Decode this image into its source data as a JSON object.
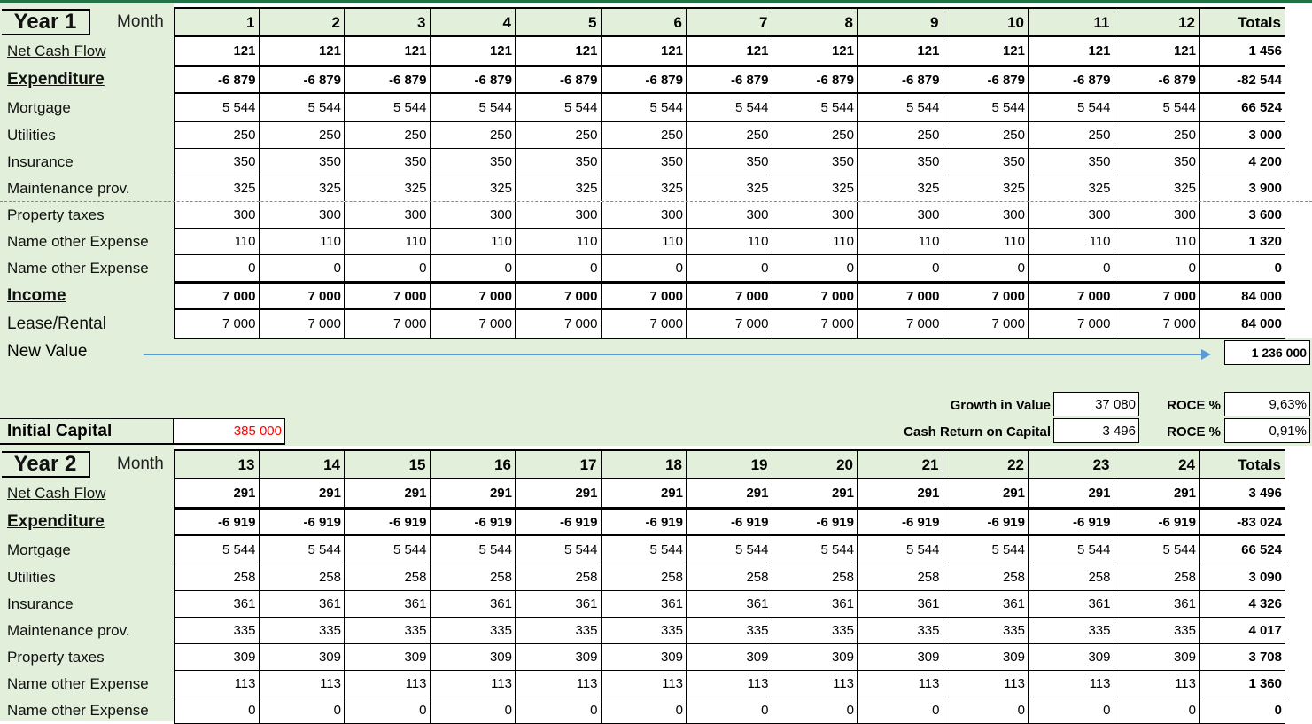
{
  "year1": {
    "title": "Year 1",
    "month_label": "Month",
    "months": [
      "1",
      "2",
      "3",
      "4",
      "5",
      "6",
      "7",
      "8",
      "9",
      "10",
      "11",
      "12"
    ],
    "totals_label": "Totals",
    "rows": [
      {
        "label": "Net Cash Flow",
        "values": [
          "121",
          "121",
          "121",
          "121",
          "121",
          "121",
          "121",
          "121",
          "121",
          "121",
          "121",
          "121"
        ],
        "total": "1 456"
      },
      {
        "label": "Expenditure",
        "values": [
          "-6 879",
          "-6 879",
          "-6 879",
          "-6 879",
          "-6 879",
          "-6 879",
          "-6 879",
          "-6 879",
          "-6 879",
          "-6 879",
          "-6 879",
          "-6 879"
        ],
        "total": "-82 544"
      },
      {
        "label": "Mortgage",
        "values": [
          "5 544",
          "5 544",
          "5 544",
          "5 544",
          "5 544",
          "5 544",
          "5 544",
          "5 544",
          "5 544",
          "5 544",
          "5 544",
          "5 544"
        ],
        "total": "66 524"
      },
      {
        "label": "Utilities",
        "values": [
          "250",
          "250",
          "250",
          "250",
          "250",
          "250",
          "250",
          "250",
          "250",
          "250",
          "250",
          "250"
        ],
        "total": "3 000"
      },
      {
        "label": "Insurance",
        "values": [
          "350",
          "350",
          "350",
          "350",
          "350",
          "350",
          "350",
          "350",
          "350",
          "350",
          "350",
          "350"
        ],
        "total": "4 200"
      },
      {
        "label": "Maintenance prov.",
        "values": [
          "325",
          "325",
          "325",
          "325",
          "325",
          "325",
          "325",
          "325",
          "325",
          "325",
          "325",
          "325"
        ],
        "total": "3 900"
      },
      {
        "label": "Property taxes",
        "values": [
          "300",
          "300",
          "300",
          "300",
          "300",
          "300",
          "300",
          "300",
          "300",
          "300",
          "300",
          "300"
        ],
        "total": "3 600"
      },
      {
        "label": "Name other Expense",
        "values": [
          "110",
          "110",
          "110",
          "110",
          "110",
          "110",
          "110",
          "110",
          "110",
          "110",
          "110",
          "110"
        ],
        "total": "1 320"
      },
      {
        "label": "Name other Expense",
        "values": [
          "0",
          "0",
          "0",
          "0",
          "0",
          "0",
          "0",
          "0",
          "0",
          "0",
          "0",
          "0"
        ],
        "total": "0"
      },
      {
        "label": "Income",
        "values": [
          "7 000",
          "7 000",
          "7 000",
          "7 000",
          "7 000",
          "7 000",
          "7 000",
          "7 000",
          "7 000",
          "7 000",
          "7 000",
          "7 000"
        ],
        "total": "84 000"
      },
      {
        "label": "Lease/Rental",
        "values": [
          "7 000",
          "7 000",
          "7 000",
          "7 000",
          "7 000",
          "7 000",
          "7 000",
          "7 000",
          "7 000",
          "7 000",
          "7 000",
          "7 000"
        ],
        "total": "84 000"
      }
    ],
    "new_value_label": "New Value",
    "new_value": "1 236 000"
  },
  "metrics": {
    "growth_label": "Growth in Value",
    "growth_value": "37 080",
    "roce_label_1": "ROCE %",
    "roce_value_1": "9,63%",
    "cash_return_label": "Cash Return on Capital",
    "cash_return_value": "3 496",
    "roce_label_2": "ROCE %",
    "roce_value_2": "0,91%"
  },
  "initial_capital": {
    "label": "Initial Capital",
    "value": "385 000",
    "value_color": "#ff0000"
  },
  "year2": {
    "title": "Year 2",
    "month_label": "Month",
    "months": [
      "13",
      "14",
      "15",
      "16",
      "17",
      "18",
      "19",
      "20",
      "21",
      "22",
      "23",
      "24"
    ],
    "totals_label": "Totals",
    "rows": [
      {
        "label": "Net Cash Flow",
        "values": [
          "291",
          "291",
          "291",
          "291",
          "291",
          "291",
          "291",
          "291",
          "291",
          "291",
          "291",
          "291"
        ],
        "total": "3 496"
      },
      {
        "label": "Expenditure",
        "values": [
          "-6 919",
          "-6 919",
          "-6 919",
          "-6 919",
          "-6 919",
          "-6 919",
          "-6 919",
          "-6 919",
          "-6 919",
          "-6 919",
          "-6 919",
          "-6 919"
        ],
        "total": "-83 024"
      },
      {
        "label": "Mortgage",
        "values": [
          "5 544",
          "5 544",
          "5 544",
          "5 544",
          "5 544",
          "5 544",
          "5 544",
          "5 544",
          "5 544",
          "5 544",
          "5 544",
          "5 544"
        ],
        "total": "66 524"
      },
      {
        "label": "Utilities",
        "values": [
          "258",
          "258",
          "258",
          "258",
          "258",
          "258",
          "258",
          "258",
          "258",
          "258",
          "258",
          "258"
        ],
        "total": "3 090"
      },
      {
        "label": "Insurance",
        "values": [
          "361",
          "361",
          "361",
          "361",
          "361",
          "361",
          "361",
          "361",
          "361",
          "361",
          "361",
          "361"
        ],
        "total": "4 326"
      },
      {
        "label": "Maintenance prov.",
        "values": [
          "335",
          "335",
          "335",
          "335",
          "335",
          "335",
          "335",
          "335",
          "335",
          "335",
          "335",
          "335"
        ],
        "total": "4 017"
      },
      {
        "label": "Property taxes",
        "values": [
          "309",
          "309",
          "309",
          "309",
          "309",
          "309",
          "309",
          "309",
          "309",
          "309",
          "309",
          "309"
        ],
        "total": "3 708"
      },
      {
        "label": "Name other Expense",
        "values": [
          "113",
          "113",
          "113",
          "113",
          "113",
          "113",
          "113",
          "113",
          "113",
          "113",
          "113",
          "113"
        ],
        "total": "1 360"
      },
      {
        "label": "Name other Expense",
        "values": [
          "0",
          "0",
          "0",
          "0",
          "0",
          "0",
          "0",
          "0",
          "0",
          "0",
          "0",
          "0"
        ],
        "total": "0"
      }
    ]
  },
  "colors": {
    "label_background": "#e2efda",
    "arrow": "#5b9bd5",
    "accent": "#217346"
  }
}
